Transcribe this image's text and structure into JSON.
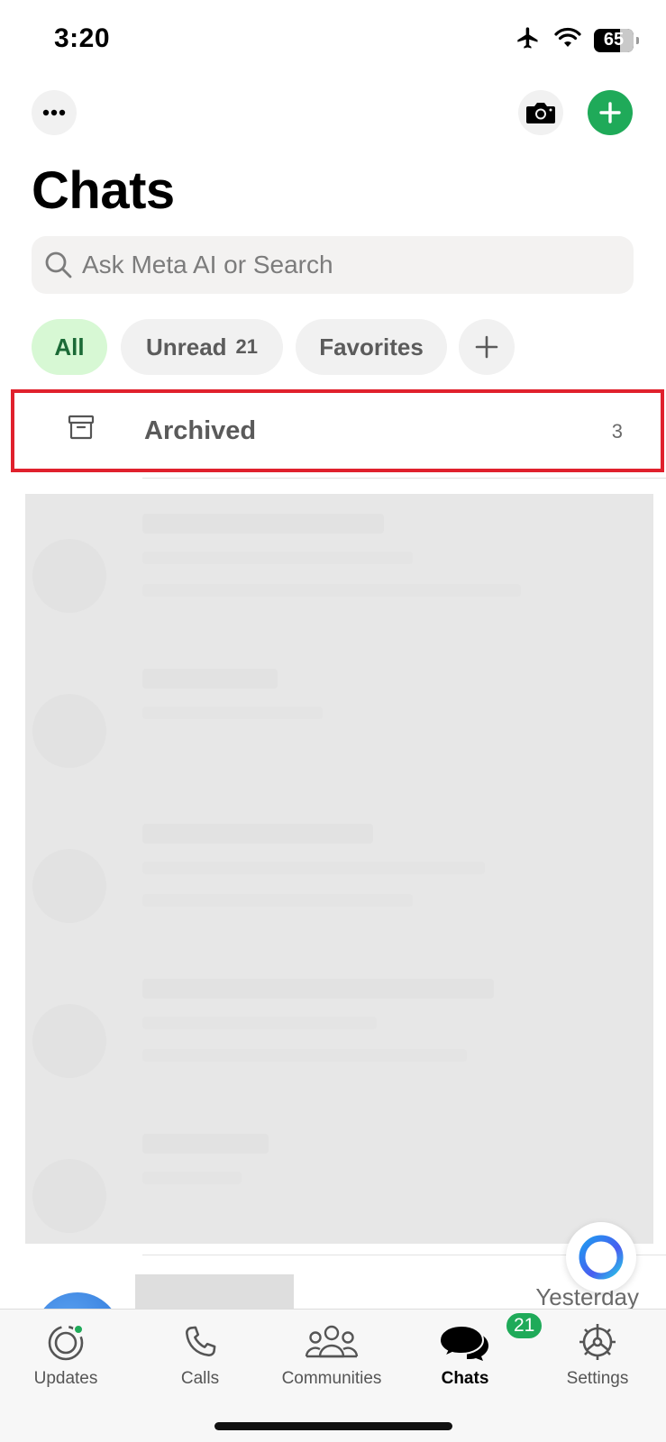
{
  "status_bar": {
    "time": "3:20",
    "battery": "65"
  },
  "header": {
    "title": "Chats"
  },
  "search": {
    "placeholder": "Ask Meta AI or Search"
  },
  "filters": {
    "all": "All",
    "unread": "Unread",
    "unread_count": "21",
    "favorites": "Favorites"
  },
  "archived": {
    "label": "Archived",
    "count": "3"
  },
  "next_chat": {
    "time": "Yesterday"
  },
  "tabs": {
    "updates": "Updates",
    "calls": "Calls",
    "communities": "Communities",
    "chats": "Chats",
    "chats_badge": "21",
    "settings": "Settings"
  },
  "colors": {
    "accent": "#1faa59",
    "highlight_border": "#e0212d",
    "chip_active_bg": "#d7f8d4"
  }
}
